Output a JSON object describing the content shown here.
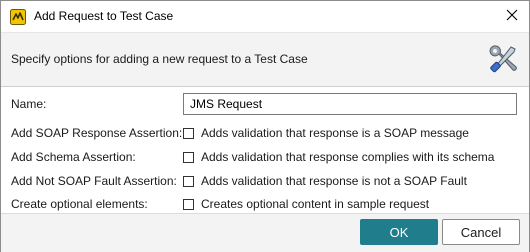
{
  "window": {
    "title": "Add Request to Test Case",
    "header_text": "Specify options for adding a new request to a Test Case"
  },
  "form": {
    "name_label": "Name:",
    "name_value": "JMS Request",
    "options": [
      {
        "label": "Add SOAP Response Assertion:",
        "text": "Adds validation that response is a SOAP message",
        "checked": false
      },
      {
        "label": "Add Schema Assertion:",
        "text": "Adds validation that response complies with its schema",
        "checked": false
      },
      {
        "label": "Add Not SOAP Fault Assertion:",
        "text": "Adds validation that response is not a SOAP Fault",
        "checked": false
      },
      {
        "label": "Create optional elements:",
        "text": "Creates optional content in sample request",
        "checked": false
      }
    ]
  },
  "buttons": {
    "ok": "OK",
    "cancel": "Cancel"
  },
  "colors": {
    "primary_button": "#1f7d8c",
    "header_bg": "#f3f3f3"
  },
  "icons": [
    "soapui-app-icon",
    "close-icon",
    "tools-icon"
  ]
}
